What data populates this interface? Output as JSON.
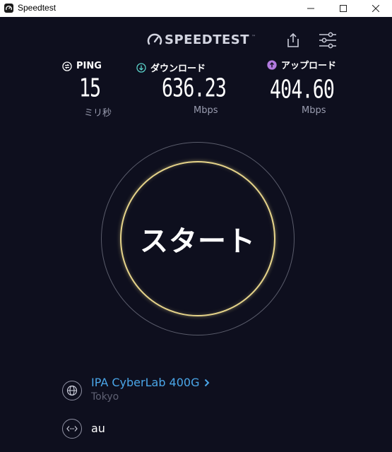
{
  "window": {
    "title": "Speedtest",
    "icon": "speedtest-app-icon",
    "controls": [
      "minimize-icon",
      "maximize-icon",
      "close-icon"
    ]
  },
  "header": {
    "logo_text": "SPEEDTEST",
    "logo_mark": "™",
    "share_icon": "share-icon",
    "settings_icon": "settings-sliders-icon"
  },
  "metrics": {
    "ping": {
      "label": "PING",
      "value": "15",
      "unit": "ミリ秒",
      "icon": "ping-icon"
    },
    "download": {
      "label": "ダウンロード",
      "value": "636.23",
      "unit": "Mbps",
      "icon": "download-arrow-icon",
      "color": "#5ad0c8"
    },
    "upload": {
      "label": "アップロード",
      "value": "404.60",
      "unit": "Mbps",
      "icon": "upload-arrow-icon",
      "color": "#b27adf"
    }
  },
  "start": {
    "label": "スタート",
    "ring_color": "#e6d48a"
  },
  "server": {
    "name": "IPA CyberLab 400G",
    "location": "Tokyo",
    "icon": "globe-icon",
    "link_color": "#4aa6e8"
  },
  "provider": {
    "name": "au",
    "icon": "connection-icon"
  }
}
